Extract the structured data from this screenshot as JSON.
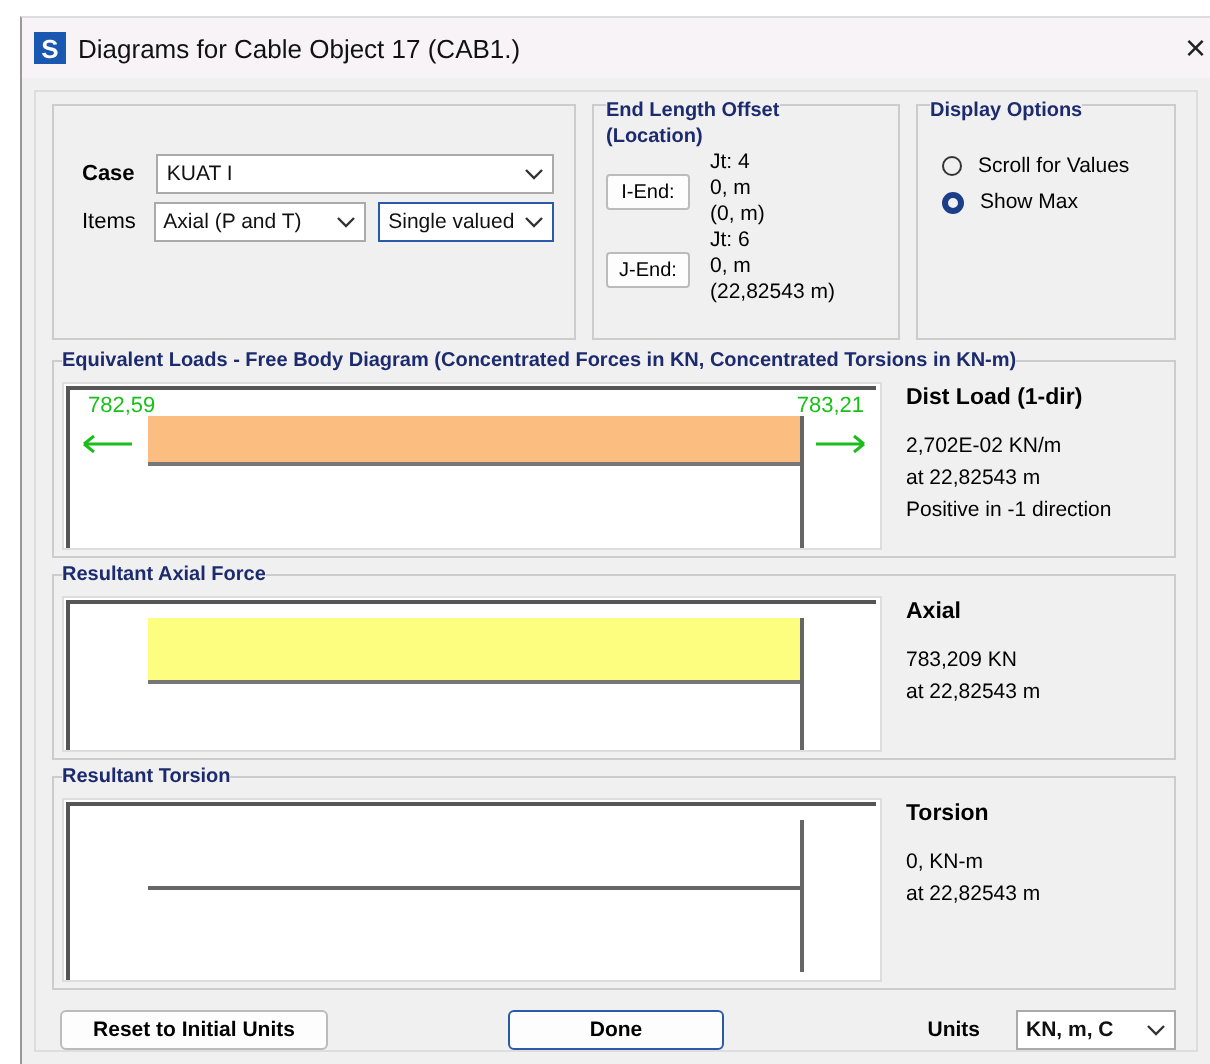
{
  "window": {
    "title": "Diagrams for Cable Object 17  (CAB1.)",
    "close": "×",
    "app_badge": "S"
  },
  "case": {
    "label": "Case",
    "value": "KUAT I"
  },
  "items": {
    "label": "Items",
    "values": [
      "Axial (P and T)",
      "Single valued"
    ]
  },
  "end_offset": {
    "title": "End Length Offset",
    "subtitle": "(Location)",
    "ends": [
      {
        "button": "I-End:",
        "joint": "Jt:  4",
        "value": "0, m",
        "location": "(0, m)"
      },
      {
        "button": "J-End:",
        "joint": "Jt:  6",
        "value": "0, m",
        "location": "(22,82543 m)"
      }
    ]
  },
  "display_options": {
    "title": "Display Options",
    "options": [
      {
        "label": "Scroll for Values",
        "selected": false
      },
      {
        "label": "Show Max",
        "selected": true
      }
    ]
  },
  "diagrams": [
    {
      "kind": "load",
      "title": "Equivalent Loads - Free Body Diagram  (Concentrated Forces in KN, Concentrated Torsions in KN-m)",
      "heading": "Dist Load (1-dir)",
      "lines": [
        "2,702E-02 KN/m",
        "at 22,82543 m",
        "Positive in -1 direction"
      ],
      "left_value": "782,59",
      "right_value": "783,21"
    },
    {
      "kind": "axial",
      "title": "Resultant Axial Force",
      "heading": "Axial",
      "lines": [
        "783,209 KN",
        "at 22,82543 m"
      ]
    },
    {
      "kind": "torsion",
      "title": "Resultant Torsion",
      "heading": "Torsion",
      "lines": [
        "0, KN-m",
        "at 22,82543 m"
      ]
    }
  ],
  "buttons": {
    "reset": "Reset to Initial Units",
    "done": "Done"
  },
  "units": {
    "label": "Units",
    "value": "KN, m, C"
  }
}
